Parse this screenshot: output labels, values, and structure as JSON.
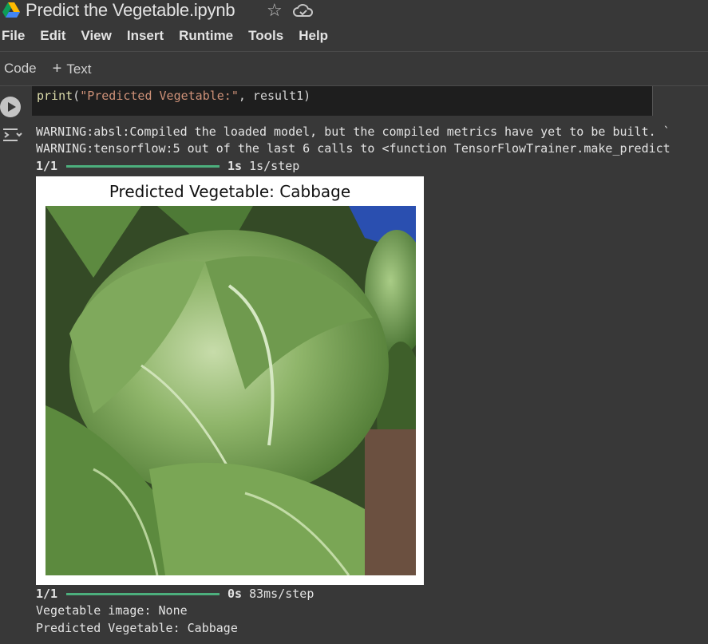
{
  "window": {
    "title": "Predict the Vegetable.ipynb"
  },
  "menu": [
    "File",
    "Edit",
    "View",
    "Insert",
    "Runtime",
    "Tools",
    "Help"
  ],
  "toolbar": {
    "code_label": "Code",
    "text_label": "Text",
    "text_prefix": "+"
  },
  "cell": {
    "code": {
      "fn": "print",
      "open": "(",
      "string": "\"Predicted Vegetable:\"",
      "rest": ", result1)"
    },
    "output": {
      "warnings": [
        "WARNING:absl:Compiled the loaded model, but the compiled metrics have yet to be built. `",
        "WARNING:tensorflow:5 out of the last 6 calls to <function TensorFlowTrainer.make_predict"
      ],
      "progress1": {
        "count": "1/1",
        "time_bold": "1s",
        "time_rest": " 1s/step",
        "fraction": 1.0
      },
      "figure_title": "Predicted Vegetable: Cabbage",
      "progress2": {
        "count": "1/1",
        "time_bold": "0s",
        "time_rest": " 83ms/step",
        "fraction": 1.0
      },
      "lines": [
        "Vegetable image: None",
        "Predicted Vegetable: Cabbage"
      ]
    }
  },
  "colors": {
    "background": "#383838",
    "code_bg": "#1e1e1e",
    "progress": "#4caf7d",
    "string": "#ce9178",
    "function": "#dcdcaa"
  },
  "icons": [
    "google-drive-icon",
    "star-icon",
    "cloud-saved-icon",
    "run-cell-icon",
    "output-toggle-icon"
  ]
}
